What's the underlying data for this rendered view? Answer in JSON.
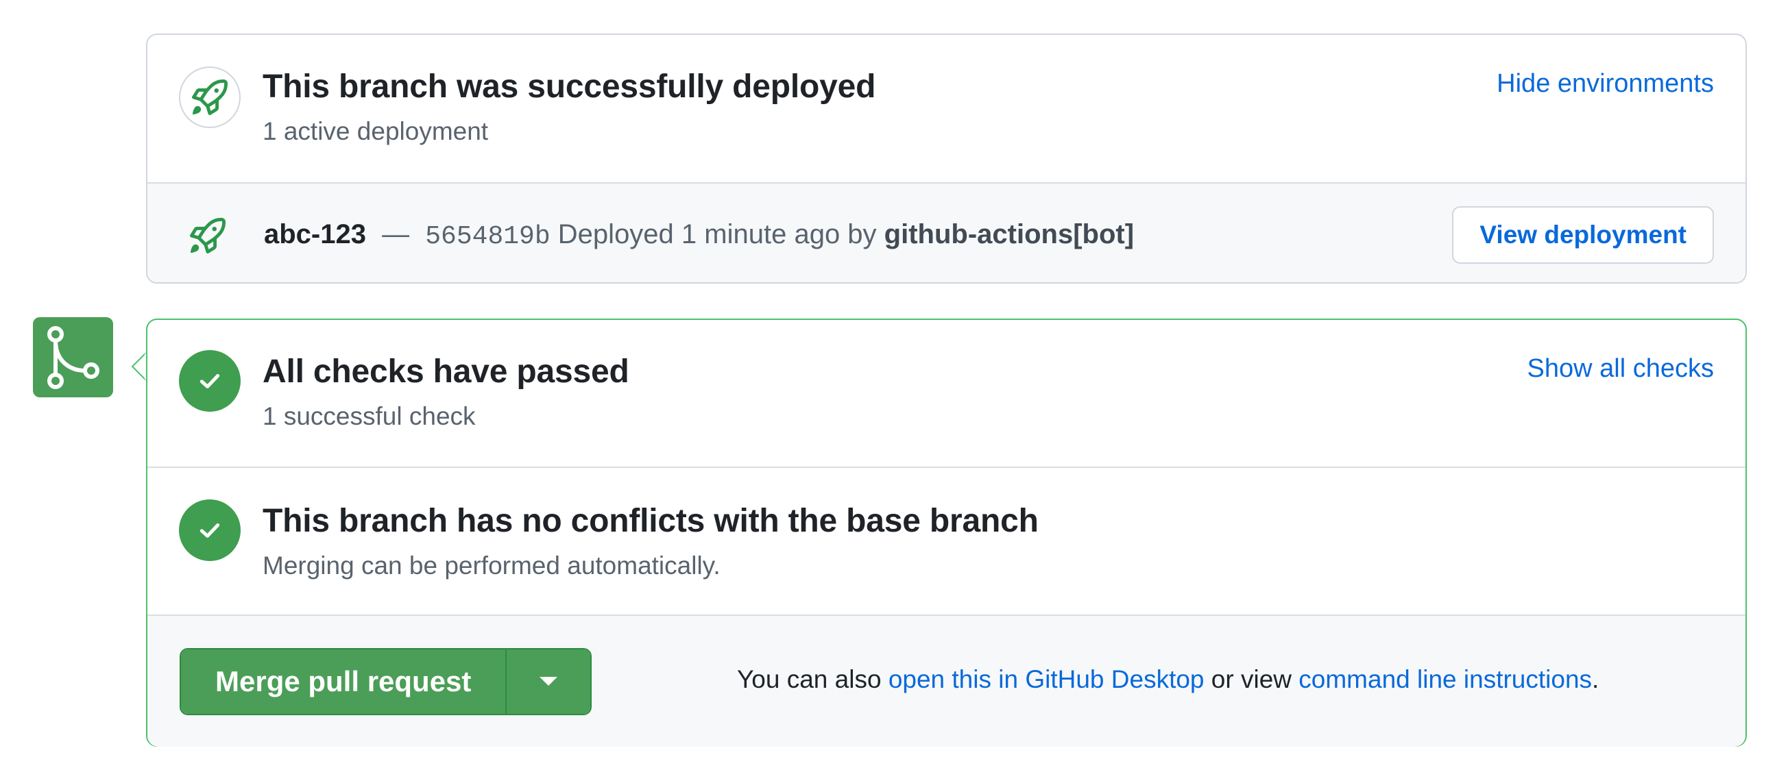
{
  "deployment": {
    "title": "This branch was successfully deployed",
    "subtitle": "1 active deployment",
    "toggle_link": "Hide environments",
    "environment": "abc-123",
    "separator": "—",
    "sha": "5654819b",
    "status_text": "Deployed 1 minute ago by",
    "actor": "github-actions[bot]",
    "view_button": "View deployment",
    "icon": "rocket-icon"
  },
  "checks": {
    "title": "All checks have passed",
    "subtitle": "1 successful check",
    "toggle_link": "Show all checks",
    "icon": "check-icon"
  },
  "conflicts": {
    "title": "This branch has no conflicts with the base branch",
    "subtitle": "Merging can be performed automatically.",
    "icon": "check-icon"
  },
  "merge": {
    "button_label": "Merge pull request",
    "dropdown_icon": "triangle-down-icon",
    "text_prefix": "You can also",
    "desktop_link": "open this in GitHub Desktop",
    "text_middle": "or view",
    "cli_link": "command line instructions",
    "text_suffix": ".",
    "side_icon": "git-merge-icon"
  },
  "colors": {
    "success": "#3f9e4f",
    "link": "#0969da",
    "border": "#d0d7de",
    "success_border": "#4ac26b"
  }
}
